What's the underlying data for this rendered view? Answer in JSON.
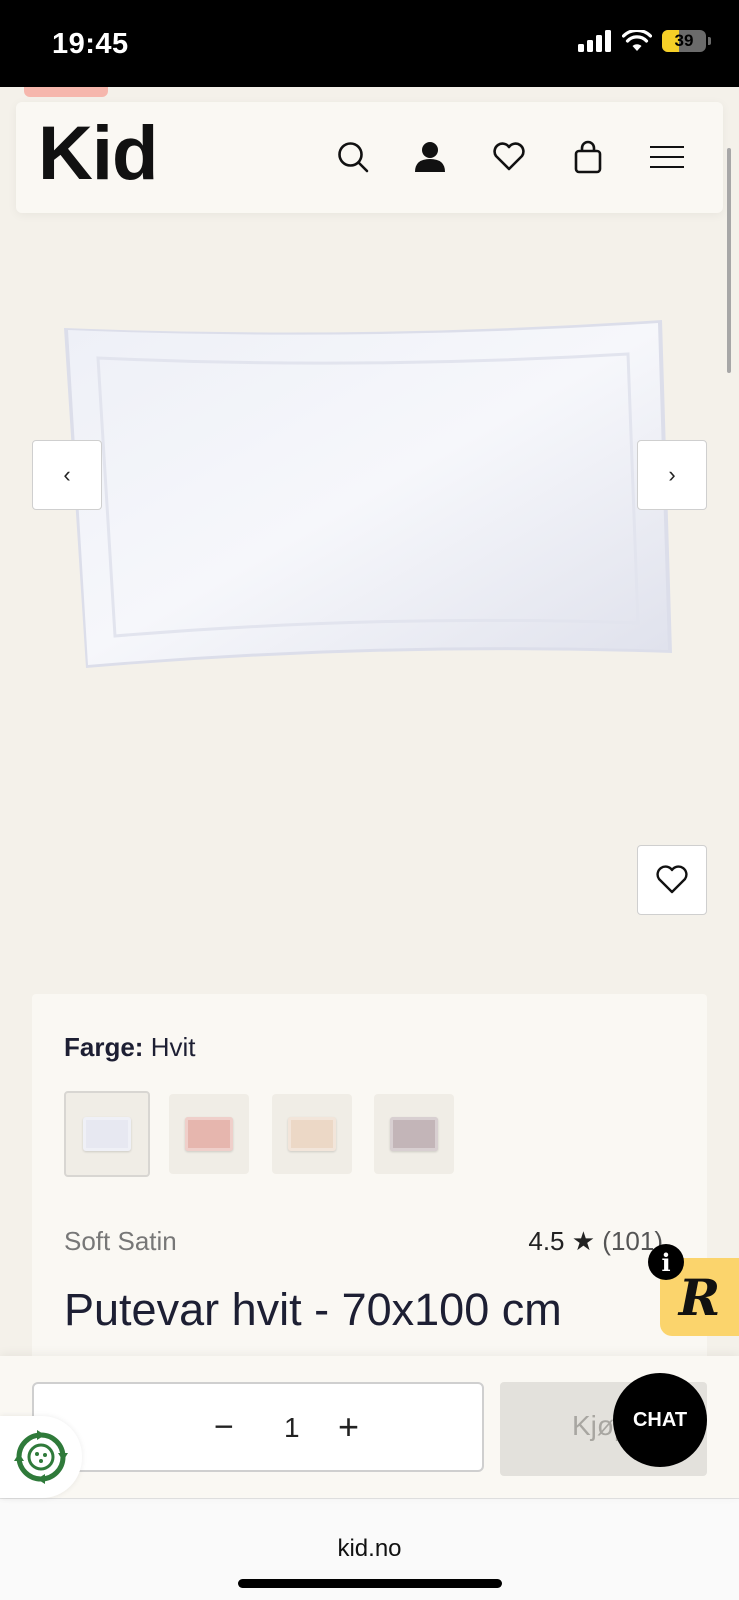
{
  "status_bar": {
    "time": "19:45",
    "battery": "39",
    "battery_level": 0.39
  },
  "header": {
    "logo": "Kid",
    "icons": [
      "search-icon",
      "account-icon",
      "heart-icon",
      "bag-icon",
      "menu-icon"
    ]
  },
  "gallery": {
    "prev_label": "‹",
    "next_label": "›"
  },
  "product": {
    "color_label": "Farge:",
    "color_value": "Hvit",
    "swatches": [
      {
        "name": "Hvit",
        "color": "#e7e8f1"
      },
      {
        "name": "Rosa",
        "color": "#e6b6ae"
      },
      {
        "name": "Beige",
        "color": "#ecd8c6"
      },
      {
        "name": "Lilla",
        "color": "#c3b5b8"
      }
    ],
    "brand": "Soft Satin",
    "rating": "4.5",
    "rating_star": "★",
    "review_count": "(101)",
    "title": "Putevar hvit - 70x100 cm"
  },
  "purchase": {
    "quantity": "1",
    "minus_label": "−",
    "plus_label": "+",
    "buy_label": "Kjøp"
  },
  "widgets": {
    "info_label": "i",
    "review_logo": "R",
    "chat_label": "CHAT"
  },
  "browser": {
    "url": "kid.no"
  },
  "colors": {
    "background": "#f4f1ea",
    "card": "#faf8f3",
    "text": "#1d1f33",
    "review_widget": "#fbd46c",
    "promo": "#f6b7ad"
  }
}
